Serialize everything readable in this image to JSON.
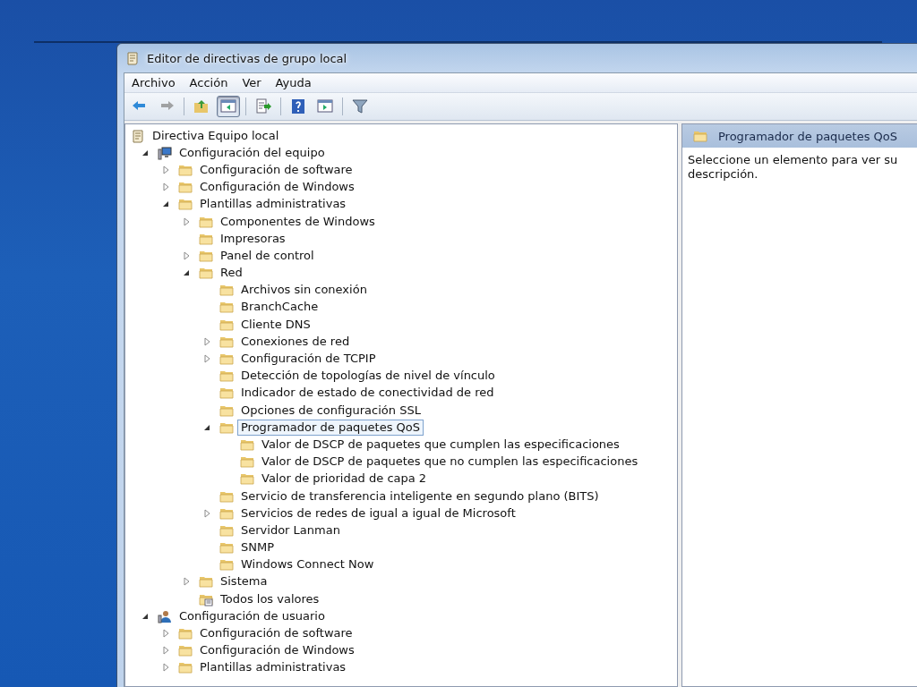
{
  "window": {
    "title": "Editor de directivas de grupo local"
  },
  "menu": [
    "Archivo",
    "Acción",
    "Ver",
    "Ayuda"
  ],
  "toolbar": [
    {
      "kind": "back",
      "disabled": false,
      "pressed": false
    },
    {
      "kind": "forward",
      "disabled": true,
      "pressed": false
    },
    {
      "kind": "separator"
    },
    {
      "kind": "up",
      "disabled": false,
      "pressed": false
    },
    {
      "kind": "tree",
      "disabled": false,
      "pressed": true
    },
    {
      "kind": "separator"
    },
    {
      "kind": "export",
      "disabled": false,
      "pressed": false
    },
    {
      "kind": "separator"
    },
    {
      "kind": "help",
      "disabled": false,
      "pressed": false
    },
    {
      "kind": "pane",
      "disabled": false,
      "pressed": false
    },
    {
      "kind": "separator"
    },
    {
      "kind": "filter",
      "disabled": false,
      "pressed": false
    }
  ],
  "tree": [
    {
      "label": "Directiva Equipo local",
      "kind": "policy",
      "selected": false,
      "children": [
        {
          "label": "Configuración del equipo",
          "kind": "computer",
          "expanded": true,
          "selected": false,
          "children": [
            {
              "label": "Configuración de software",
              "kind": "folder",
              "expanded": false,
              "selected": false
            },
            {
              "label": "Configuración de Windows",
              "kind": "folder",
              "expanded": false,
              "selected": false
            },
            {
              "label": "Plantillas administrativas",
              "kind": "folder",
              "expanded": true,
              "selected": false,
              "children": [
                {
                  "label": "Componentes de Windows",
                  "kind": "folder",
                  "expanded": false,
                  "selected": false
                },
                {
                  "label": "Impresoras",
                  "kind": "folder",
                  "selected": false
                },
                {
                  "label": "Panel de control",
                  "kind": "folder",
                  "expanded": false,
                  "selected": false
                },
                {
                  "label": "Red",
                  "kind": "folder",
                  "expanded": true,
                  "selected": false,
                  "children": [
                    {
                      "label": "Archivos sin conexión",
                      "kind": "folder",
                      "selected": false
                    },
                    {
                      "label": "BranchCache",
                      "kind": "folder",
                      "selected": false
                    },
                    {
                      "label": "Cliente DNS",
                      "kind": "folder",
                      "selected": false
                    },
                    {
                      "label": "Conexiones de red",
                      "kind": "folder",
                      "expanded": false,
                      "selected": false
                    },
                    {
                      "label": "Configuración de TCPIP",
                      "kind": "folder",
                      "expanded": false,
                      "selected": false
                    },
                    {
                      "label": "Detección de topologías de nivel de vínculo",
                      "kind": "folder",
                      "selected": false
                    },
                    {
                      "label": "Indicador de estado de conectividad de red",
                      "kind": "folder",
                      "selected": false
                    },
                    {
                      "label": "Opciones de configuración SSL",
                      "kind": "folder",
                      "selected": false
                    },
                    {
                      "label": "Programador de paquetes QoS",
                      "kind": "folder",
                      "expanded": true,
                      "selected": true,
                      "children": [
                        {
                          "label": "Valor de DSCP de paquetes que cumplen las especificaciones",
                          "kind": "folder",
                          "selected": false
                        },
                        {
                          "label": "Valor de DSCP de paquetes que no cumplen las especificaciones",
                          "kind": "folder",
                          "selected": false
                        },
                        {
                          "label": "Valor de prioridad de capa 2",
                          "kind": "folder",
                          "selected": false
                        }
                      ]
                    },
                    {
                      "label": "Servicio de transferencia inteligente en segundo plano (BITS)",
                      "kind": "folder",
                      "selected": false
                    },
                    {
                      "label": "Servicios de redes de igual a igual de Microsoft",
                      "kind": "folder",
                      "expanded": false,
                      "selected": false
                    },
                    {
                      "label": "Servidor Lanman",
                      "kind": "folder",
                      "selected": false
                    },
                    {
                      "label": "SNMP",
                      "kind": "folder",
                      "selected": false
                    },
                    {
                      "label": "Windows Connect Now",
                      "kind": "folder",
                      "selected": false
                    }
                  ]
                },
                {
                  "label": "Sistema",
                  "kind": "folder",
                  "expanded": false,
                  "selected": false
                },
                {
                  "label": "Todos los valores",
                  "kind": "settings",
                  "selected": false
                }
              ]
            }
          ]
        },
        {
          "label": "Configuración de usuario",
          "kind": "user",
          "expanded": true,
          "selected": false,
          "children": [
            {
              "label": "Configuración de software",
              "kind": "folder",
              "expanded": false,
              "selected": false
            },
            {
              "label": "Configuración de Windows",
              "kind": "folder",
              "expanded": false,
              "selected": false
            },
            {
              "label": "Plantillas administrativas",
              "kind": "folder",
              "expanded": false,
              "selected": false
            }
          ]
        }
      ]
    }
  ],
  "details": {
    "title": "Programador de paquetes QoS",
    "description": "Seleccione un elemento para ver su descripción."
  }
}
